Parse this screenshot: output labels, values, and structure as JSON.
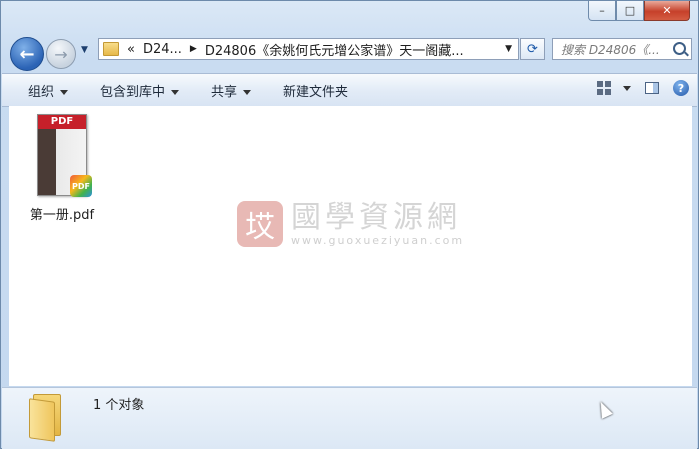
{
  "window": {
    "caption_buttons": {
      "minimize": "–",
      "maximize": "□",
      "close": "✕"
    }
  },
  "nav": {
    "back_glyph": "←",
    "forward_glyph": "→",
    "history_dropdown": "▼"
  },
  "address": {
    "overflow": "«",
    "crumb_parent": "D24...",
    "crumb_current": "D24806《余姚何氏元增公家谱》天一阁藏..."
  },
  "refresh_glyph": "⟳",
  "search": {
    "placeholder": "搜索 D24806《..."
  },
  "toolbar": {
    "organize": "组织",
    "include_in_library": "包含到库中",
    "share": "共享",
    "new_folder": "新建文件夹",
    "help": "?"
  },
  "files": [
    {
      "name": "第一册.pdf",
      "icon": "pdf-file-icon",
      "band": "PDF",
      "badge": "PDF"
    }
  ],
  "watermark": {
    "seal": "㘷",
    "chinese": "國學資源網",
    "url": "www.guoxueziyuan.com"
  },
  "status": {
    "count": "1 个对象"
  },
  "colors": {
    "accent": "#2b63b5",
    "close": "#c6402a",
    "pdf_red": "#c6202a"
  }
}
